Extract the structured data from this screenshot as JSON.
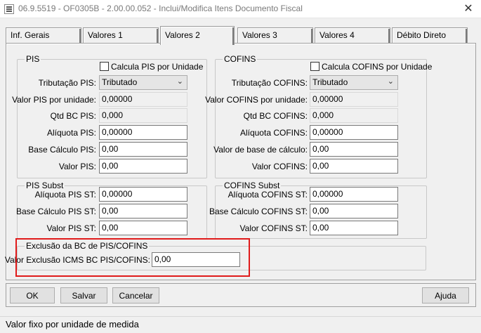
{
  "window": {
    "title": "06.9.5519 - OF0305B - 2.00.00.052 - Inclui/Modifica Itens Documento Fiscal",
    "close_glyph": "✕"
  },
  "tabs": [
    {
      "label": "Inf. Gerais",
      "active": false
    },
    {
      "label": "Valores 1",
      "active": false
    },
    {
      "label": "Valores 2",
      "active": true
    },
    {
      "label": "Valores 3",
      "active": false
    },
    {
      "label": "Valores 4",
      "active": false
    },
    {
      "label": "Débito Direto",
      "active": false
    }
  ],
  "pis": {
    "title": "PIS",
    "calc_unit_label": "Calcula PIS por Unidade",
    "tributacao_label": "Tributação PIS:",
    "tributacao_value": "Tributado",
    "valor_unidade_label": "Valor PIS por unidade:",
    "valor_unidade_value": "0,00000",
    "qtd_bc_label": "Qtd BC PIS:",
    "qtd_bc_value": "0,000",
    "aliquota_label": "Alíquota PIS:",
    "aliquota_value": "0,00000",
    "base_calculo_label": "Base Cálculo PIS:",
    "base_calculo_value": "0,00",
    "valor_label": "Valor PIS:",
    "valor_value": "0,00"
  },
  "cofins": {
    "title": "COFINS",
    "calc_unit_label": "Calcula COFINS por Unidade",
    "tributacao_label": "Tributação COFINS:",
    "tributacao_value": "Tributado",
    "valor_unidade_label": "Valor COFINS por unidade:",
    "valor_unidade_value": "0,00000",
    "qtd_bc_label": "Qtd BC COFINS:",
    "qtd_bc_value": "0,000",
    "aliquota_label": "Alíquota COFINS:",
    "aliquota_value": "0,00000",
    "base_calculo_label": "Valor de base de cálculo:",
    "base_calculo_value": "0,00",
    "valor_label": "Valor COFINS:",
    "valor_value": "0,00"
  },
  "pis_subst": {
    "title": "PIS Subst",
    "aliquota_label": "Alíquota PIS ST:",
    "aliquota_value": "0,00000",
    "base_calculo_label": "Base Cálculo PIS ST:",
    "base_calculo_value": "0,00",
    "valor_label": "Valor PIS ST:",
    "valor_value": "0,00"
  },
  "cofins_subst": {
    "title": "COFINS Subst",
    "aliquota_label": "Alíquota COFINS ST:",
    "aliquota_value": "0,00000",
    "base_calculo_label": "Base Cálculo COFINS ST:",
    "base_calculo_value": "0,00",
    "valor_label": "Valor COFINS ST:",
    "valor_value": "0,00"
  },
  "exclusao": {
    "title": "Exclusão da BC de PIS/COFINS",
    "valor_label": "Valor Exclusão ICMS BC PIS/COFINS:",
    "valor_value": "0,00"
  },
  "buttons": {
    "ok": "OK",
    "salvar": "Salvar",
    "cancelar": "Cancelar",
    "ajuda": "Ajuda"
  },
  "status": {
    "text": "Valor fixo por unidade de medida"
  },
  "colors": {
    "highlight": "#e01b1b",
    "background": "#f0f0f0"
  }
}
